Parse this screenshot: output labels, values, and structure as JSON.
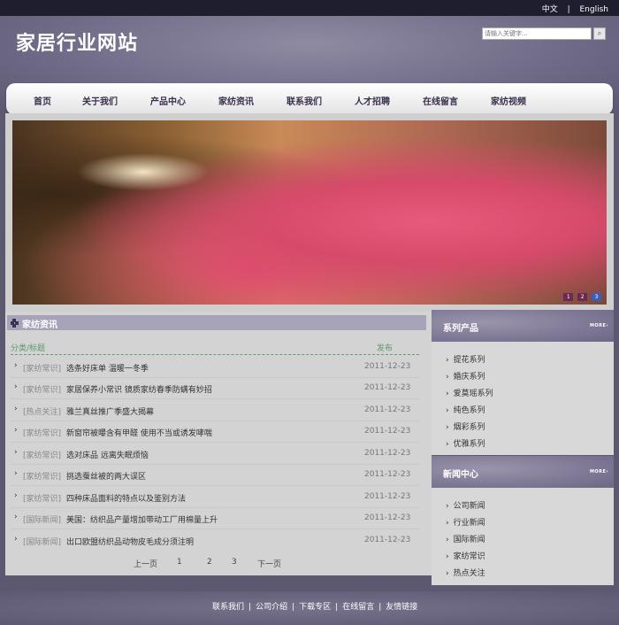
{
  "topbar": {
    "lang_cn": "中文",
    "separator": "|",
    "lang_en": "English"
  },
  "header": {
    "site_title": "家居行业网站",
    "search_placeholder": "请输入关键字...",
    "search_button_icon": "search-icon"
  },
  "nav": [
    "首页",
    "关于我们",
    "产品中心",
    "家纺资讯",
    "联系我们",
    "人才招聘",
    "在线留言",
    "家纺视频"
  ],
  "banner": {
    "dots": [
      "1",
      "2",
      "3"
    ],
    "active_dot": 2
  },
  "news": {
    "title": "家纺资讯",
    "col_category": "分类/标题",
    "col_date": "发布",
    "items": [
      {
        "category": "[家纺常识]",
        "title": "选条好床单 温暖一冬季",
        "date": "2011-12-23"
      },
      {
        "category": "[家纺常识]",
        "title": "家居保养小常识 镜质家纺春季防螨有妙招",
        "date": "2011-12-23"
      },
      {
        "category": "[热点关注]",
        "title": "雅兰真丝推广季盛大揭幕",
        "date": "2011-12-23"
      },
      {
        "category": "[家纺常识]",
        "title": "新窗帘被曝含有甲醛 使用不当或诱发哮喘",
        "date": "2011-12-23"
      },
      {
        "category": "[家纺常识]",
        "title": "选对床品 远离失眠烦恼",
        "date": "2011-12-23"
      },
      {
        "category": "[家纺常识]",
        "title": "挑选蚕丝被的两大误区",
        "date": "2011-12-23"
      },
      {
        "category": "[家纺常识]",
        "title": "四种床品面料的特点以及鉴别方法",
        "date": "2011-12-23"
      },
      {
        "category": "[国际新闻]",
        "title": "美国：纺织品产量增加带动工厂用棉量上升",
        "date": "2011-12-23"
      },
      {
        "category": "[国际新闻]",
        "title": "出口欧盟纺织品动物皮毛成分须注明",
        "date": "2011-12-23"
      }
    ],
    "pager": {
      "prev": "上一页",
      "pages": [
        "1",
        "2",
        "3"
      ],
      "next": "下一页"
    }
  },
  "side": {
    "products": {
      "title": "系列产品",
      "more": "MORE",
      "items": [
        "提花系列",
        "婚庆系列",
        "爱莫瑶系列",
        "纯色系列",
        "烟彩系列",
        "优雅系列"
      ]
    },
    "news_center": {
      "title": "新闻中心",
      "more": "MORE",
      "items": [
        "公司新闻",
        "行业新闻",
        "国际新闻",
        "家纺常识",
        "热点关注"
      ]
    }
  },
  "footer": {
    "links": [
      "联系我们",
      "公司介绍",
      "下载专区",
      "在线留言",
      "友情链接"
    ],
    "separator": "|"
  }
}
